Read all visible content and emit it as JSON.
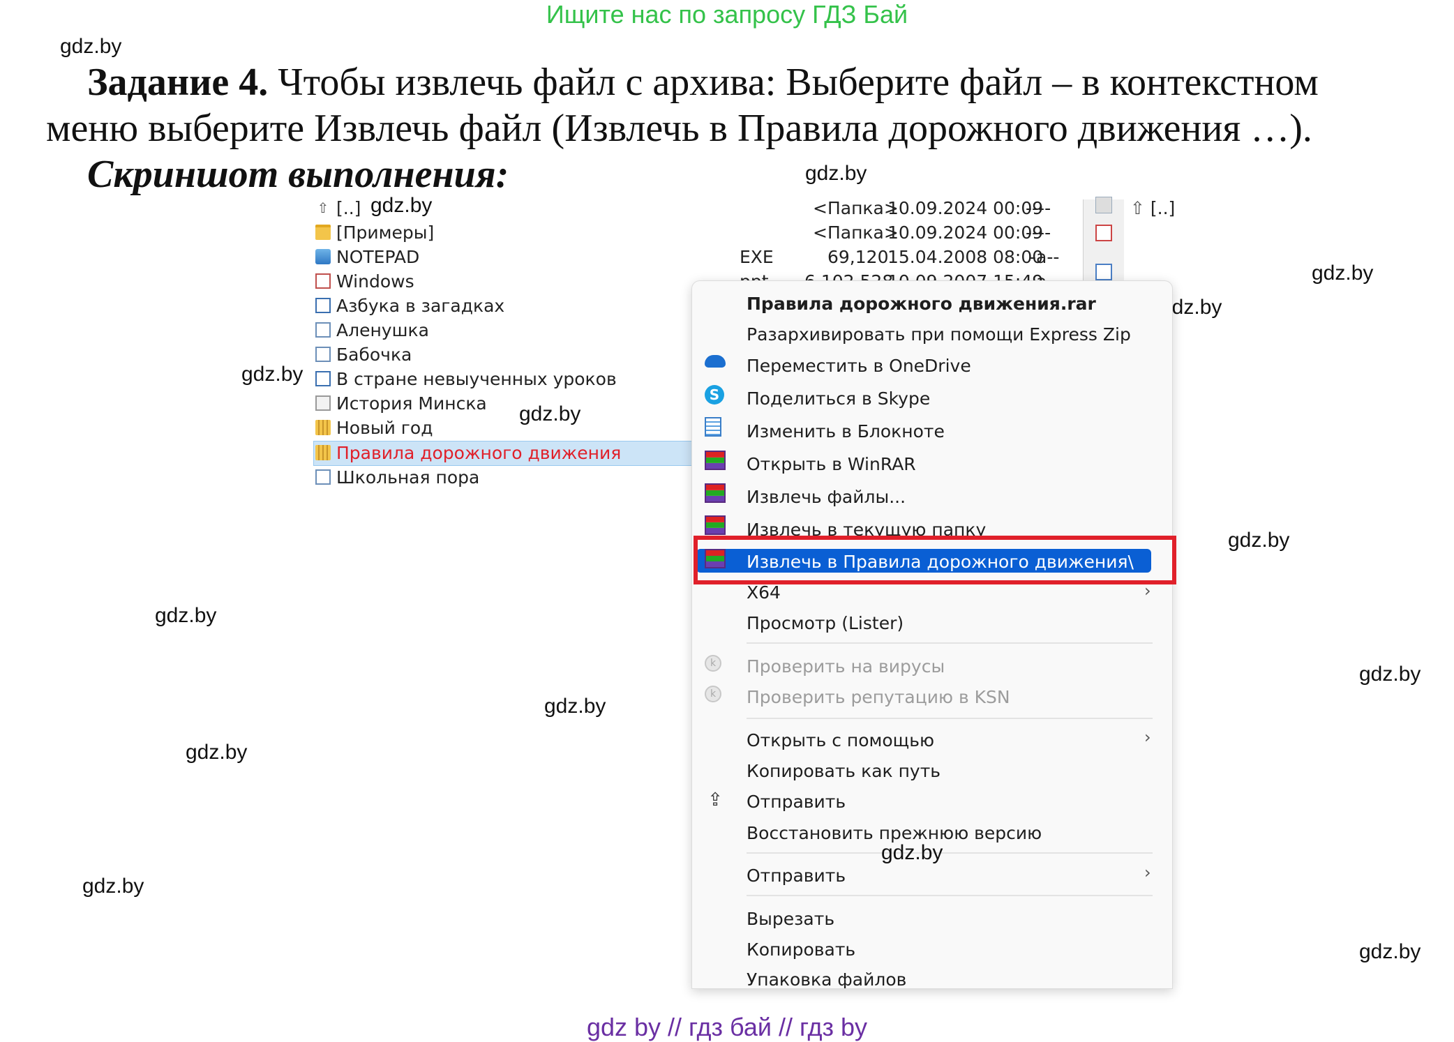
{
  "banner": "Ищите нас по запросу ГДЗ Бай",
  "watermark": "gdz.by",
  "task": {
    "label": "Задание 4.",
    "line1": "Чтобы извлечь файл с архива: Выберите файл – в контекстном",
    "line2": "меню выберите Извлечь файл (Извлечь в Правила дорожного движения …).",
    "caption": "Скриншот выполнения:"
  },
  "file_list": [
    {
      "name": "[..]",
      "icon": "up-icon"
    },
    {
      "name": "[Примеры]",
      "icon": "folder-icon"
    },
    {
      "name": "NOTEPAD",
      "icon": "exe-icon"
    },
    {
      "name": "Windows",
      "icon": "document-icon"
    },
    {
      "name": "Азбука в загадках",
      "icon": "document-icon"
    },
    {
      "name": "Аленушка",
      "icon": "document-icon"
    },
    {
      "name": "Бабочка",
      "icon": "document-icon"
    },
    {
      "name": "В стране невыученных уроков",
      "icon": "document-icon"
    },
    {
      "name": "История Минска",
      "icon": "text-file-icon"
    },
    {
      "name": "Новый год",
      "icon": "archive-icon"
    },
    {
      "name": "Правила дорожного движения",
      "icon": "archive-icon",
      "selected": true
    },
    {
      "name": "Школьная пора",
      "icon": "document-icon"
    }
  ],
  "details": [
    {
      "ext": "",
      "size": "<Папка>",
      "date": "10.09.2024 00:09",
      "attr": "----"
    },
    {
      "ext": "",
      "size": "<Папка>",
      "date": "10.09.2024 00:09",
      "attr": "----"
    },
    {
      "ext": "EXE",
      "size": "69,120",
      "date": "15.04.2008 08:00",
      "attr": "-a--"
    },
    {
      "ext": "ppt",
      "size": "6 102 528",
      "date": "10.09.2007 15:49",
      "attr": "-a-"
    }
  ],
  "right_panel": {
    "up_label": "[..]"
  },
  "context_menu": {
    "title": "Правила дорожного движения.rar",
    "items": {
      "express_zip": "Разархивировать при помощи Express Zip",
      "onedrive": "Переместить в OneDrive",
      "skype": "Поделиться в Skype",
      "notepad": "Изменить в Блокноте",
      "open_winrar": "Открыть в WinRAR",
      "extract_files": "Извлечь файлы...",
      "extract_here": "Извлечь в текущую папку",
      "extract_to": "Извлечь в Правила дорожного движения\\",
      "x64": "X64",
      "lister": "Просмотр (Lister)",
      "virus_check": "Проверить на вирусы",
      "ksn_check": "Проверить репутацию в KSN",
      "open_with": "Открыть с помощью",
      "copy_path": "Копировать как путь",
      "share": "Отправить",
      "restore": "Восстановить прежнюю версию",
      "send_to": "Отправить",
      "cut": "Вырезать",
      "copy": "Копировать",
      "pack": "Упаковка файлов"
    },
    "chevron": "›"
  },
  "colors": {
    "banner": "#34c24a",
    "highlight": "#0a5fd4",
    "annotation_box": "#e0202a",
    "selected_text": "#e0202a",
    "footer": "#6a2fa3"
  },
  "footer": "gdz by  //  гдз бай  //  гдз by"
}
